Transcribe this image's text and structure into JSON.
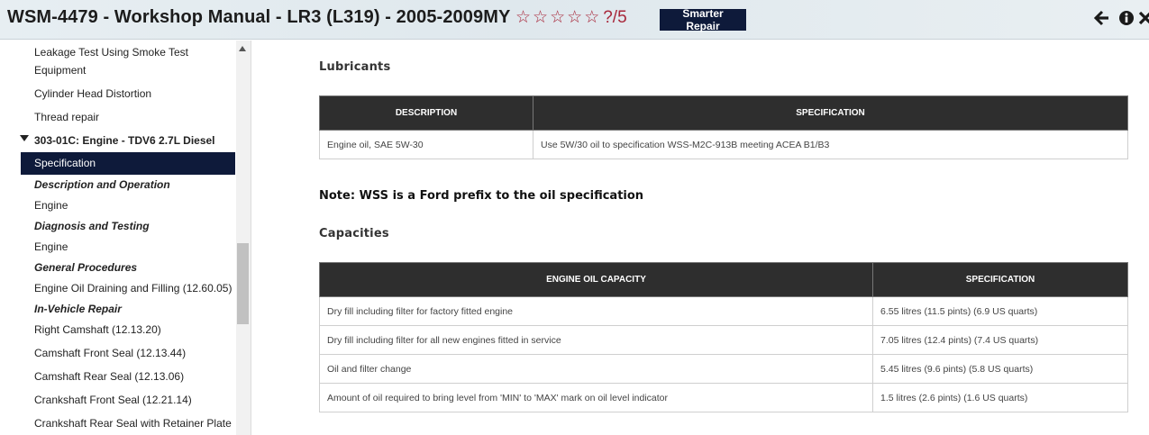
{
  "header": {
    "title": "WSM-4479 - Workshop Manual - LR3 (L319) - 2005-2009MY",
    "rating_text": "?/5",
    "smarter_repair_label": "Smarter Repair",
    "icons": [
      "back-arrow-icon",
      "info-icon",
      "close-icon"
    ]
  },
  "sidebar": {
    "items": [
      "Leakage Test Using Smoke Test Equipment",
      "Cylinder Head Distortion",
      "Thread repair",
      "303-01C: Engine - TDV6 2.7L Diesel",
      "Specification",
      "Description and Operation",
      "Engine",
      "Diagnosis and Testing",
      "Engine",
      "General Procedures",
      "Engine Oil Draining and Filling (12.60.05)",
      "In-Vehicle Repair",
      "Right Camshaft (12.13.20)",
      "Camshaft Front Seal (12.13.44)",
      "Camshaft Rear Seal (12.13.06)",
      "Crankshaft Front Seal (12.21.14)",
      "Crankshaft Rear Seal with Retainer Plate"
    ],
    "active_index": 4
  },
  "main": {
    "lubricants": {
      "heading": "Lubricants",
      "columns": [
        "DESCRIPTION",
        "SPECIFICATION"
      ],
      "rows": [
        [
          "Engine oil, SAE 5W-30",
          "Use 5W/30 oil to specification WSS-M2C-913B meeting ACEA B1/B3"
        ]
      ]
    },
    "note": "Note: WSS is a Ford prefix to the oil specification",
    "capacities": {
      "heading": "Capacities",
      "columns": [
        "ENGINE OIL CAPACITY",
        "SPECIFICATION"
      ],
      "rows": [
        [
          "Dry fill including filter for factory fitted engine",
          "6.55 litres (11.5 pints) (6.9 US quarts)"
        ],
        [
          "Dry fill including filter for all new engines fitted in service",
          "7.05 litres (12.4 pints) (7.4 US quarts)"
        ],
        [
          "Oil and filter change",
          "5.45 litres (9.6 pints) (5.8 US quarts)"
        ],
        [
          "Amount of oil required to bring level from 'MIN' to 'MAX' mark on oil level indicator",
          "1.5 litres (2.6 pints) (1.6 US quarts)"
        ]
      ]
    }
  },
  "colors": {
    "brand_navy": "#0e1a3a",
    "star_red": "#a8273a",
    "table_header": "#2e2e2e"
  }
}
